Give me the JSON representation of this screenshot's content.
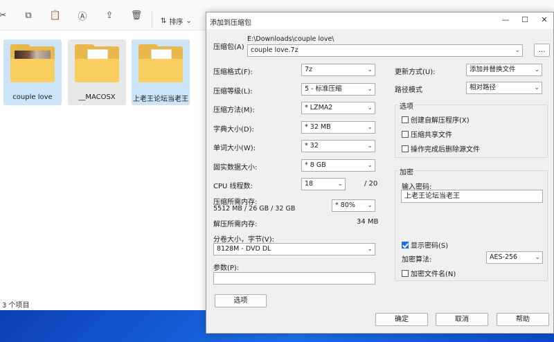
{
  "explorer": {
    "sort_label": "排序",
    "files": [
      {
        "name": "couple love",
        "type": "photo-folder",
        "selected": true
      },
      {
        "name": "__MACOSX",
        "type": "folder",
        "selected": false
      },
      {
        "name": "上老王论坛当老王",
        "type": "folder",
        "selected": true
      }
    ],
    "status": "3 个项目"
  },
  "dialog": {
    "title": "添加到压缩包",
    "archive_label": "压缩包(A)",
    "archive_path": "E:\\Downloads\\couple love\\",
    "archive_name": "couple love.7z",
    "browse_label": "...",
    "format_label": "压缩格式(F):",
    "format_value": "7z",
    "level_label": "压缩等级(L):",
    "level_value": "5 - 标准压缩",
    "method_label": "压缩方法(M):",
    "method_value": "*  LZMA2",
    "dict_label": "字典大小(D):",
    "dict_value": "*  32 MB",
    "word_label": "单词大小(W):",
    "word_value": "*  32",
    "solid_label": "固实数据大小:",
    "solid_value": "*  8 GB",
    "threads_label": "CPU 线程数:",
    "threads_value": "18",
    "threads_total": "/ 20",
    "mem_label": "压缩所需内存:",
    "mem_detail": "5512 MB / 26 GB / 32 GB",
    "mem_value": "*  80%",
    "decomp_label": "解压所需内存:",
    "decomp_value": "34 MB",
    "split_label": "分卷大小，字节(V):",
    "split_value": "8128M - DVD DL",
    "params_label": "参数(P):",
    "params_value": "",
    "options_button": "选项",
    "update_label": "更新方式(U):",
    "update_value": "添加并替换文件",
    "path_label": "路径模式",
    "path_value": "相对路径",
    "options_group": "选项",
    "opt_sfx": "创建自解压程序(X)",
    "opt_shared": "压缩共享文件",
    "opt_delete": "操作完成后删除源文件",
    "encrypt_group": "加密",
    "password_label": "输入密码:",
    "password_value": "上老王论坛当老王",
    "show_password": "显示密码(S)",
    "enc_method_label": "加密算法:",
    "enc_method_value": "AES-256",
    "encrypt_names": "加密文件名(N)",
    "ok_label": "确定",
    "cancel_label": "取消",
    "help_label": "帮助"
  },
  "colors": {
    "accent": "#1b6ee8",
    "folder": "#f8cf5f",
    "selection": "#cce4f7"
  }
}
